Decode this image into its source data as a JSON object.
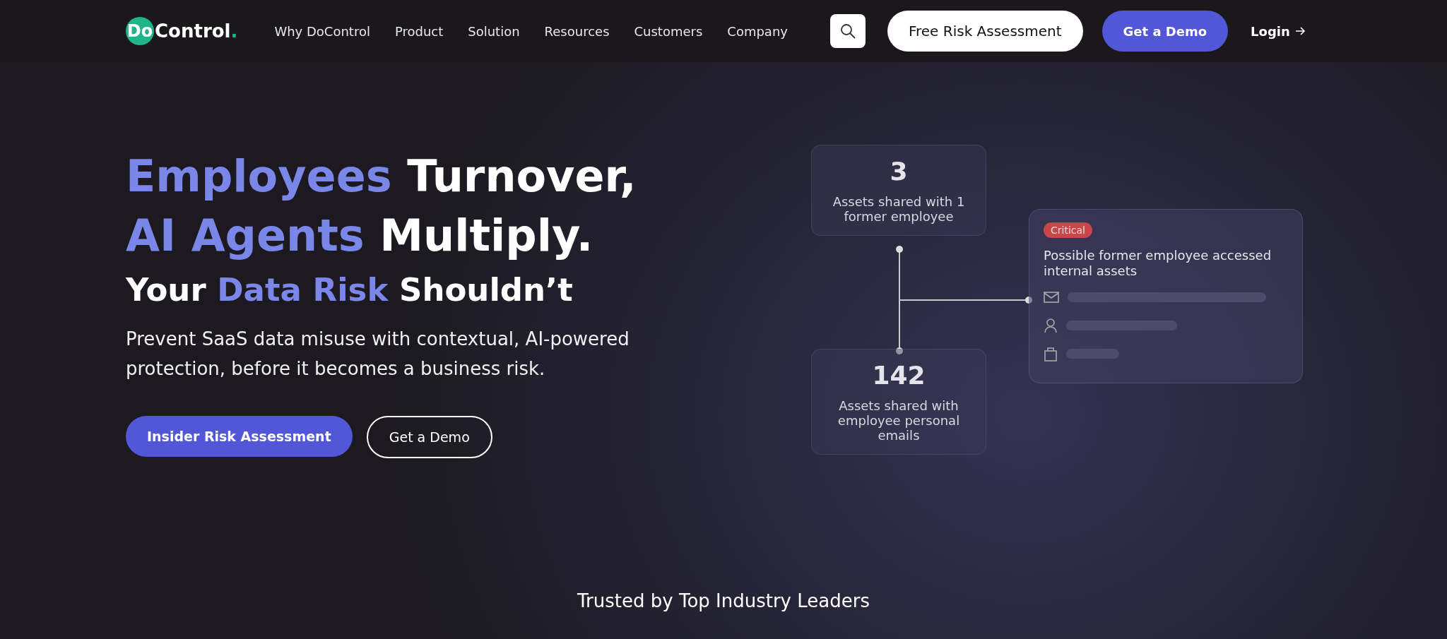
{
  "header": {
    "logo": {
      "mark": "Do",
      "text": "Control",
      "dot": "."
    },
    "nav": [
      "Why DoControl",
      "Product",
      "Solution",
      "Resources",
      "Customers",
      "Company"
    ],
    "buttons": [
      {
        "label": "Free Risk Assessment",
        "kind": "light"
      },
      {
        "label": "Get a Demo",
        "kind": "primary"
      }
    ],
    "login": "Login"
  },
  "hero": {
    "headline": [
      [
        {
          "text": "Employees",
          "accent": true
        },
        {
          "text": " Turnover,",
          "accent": false
        }
      ],
      [
        {
          "text": "AI Agents",
          "accent": true
        },
        {
          "text": " Multiply.",
          "accent": false
        }
      ]
    ],
    "subheadline": [
      {
        "text": "Your ",
        "accent": false
      },
      {
        "text": "Data Risk",
        "accent": true
      },
      {
        "text": " Shouldn’t",
        "accent": false
      }
    ],
    "description": "Prevent SaaS data misuse with contextual, AI-powered protection, before it becomes a business risk.",
    "buttons": [
      {
        "label": "Insider Risk Assessment",
        "kind": "primary"
      },
      {
        "label": "Get a Demo",
        "kind": "outline"
      }
    ]
  },
  "diagram": {
    "stats": [
      {
        "value": "3",
        "label": "Assets shared with 1 former employee"
      },
      {
        "value": "142",
        "label": "Assets shared with employee personal emails"
      }
    ],
    "alert": {
      "badge": "Critical",
      "title": "Possible former employee accessed internal assets",
      "rows": [
        {
          "kind": "email"
        },
        {
          "kind": "user"
        },
        {
          "kind": "bag"
        }
      ]
    }
  },
  "trusted": "Trusted by Top Industry Leaders"
}
